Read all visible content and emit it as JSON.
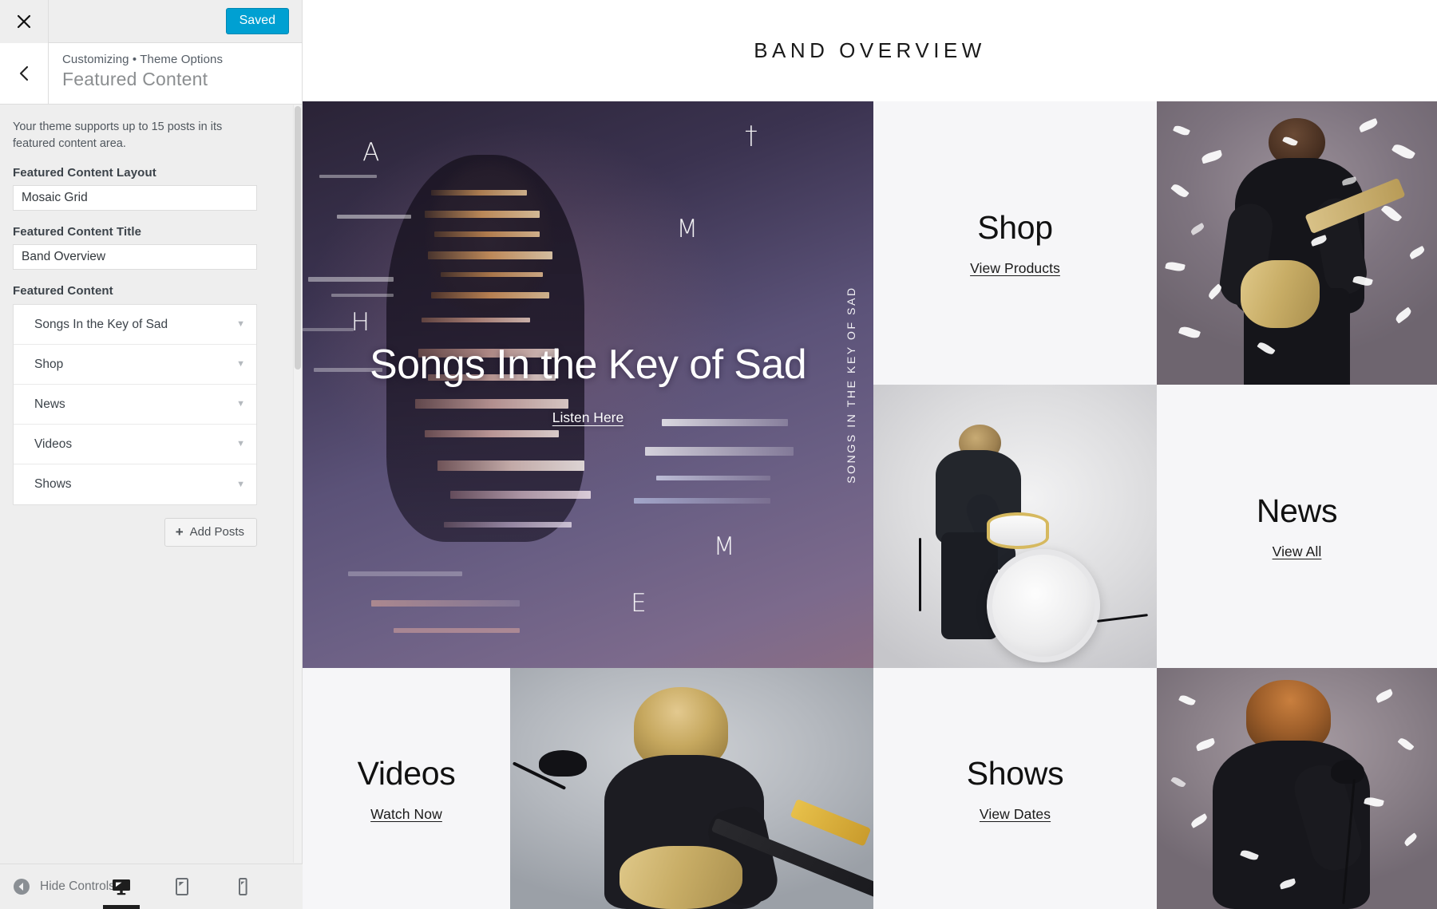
{
  "customizer": {
    "close_label": "Close",
    "save_label": "Saved",
    "back_label": "Back",
    "breadcrumb": "Customizing • Theme Options",
    "panel_name": "Featured Content",
    "accent_color": "#00a0d2",
    "description": "Your theme supports up to 15 posts in its featured content area.",
    "fields": [
      {
        "label": "Featured Content Layout",
        "value": "Mosaic Grid"
      },
      {
        "label": "Featured Content Title",
        "value": "Band Overview"
      }
    ],
    "featured_content": {
      "label": "Featured Content",
      "items": [
        {
          "title": "Songs In the Key of Sad"
        },
        {
          "title": "Shop"
        },
        {
          "title": "News"
        },
        {
          "title": "Videos"
        },
        {
          "title": "Shows"
        }
      ]
    },
    "add_posts_label": "Add Posts",
    "footer": {
      "hide_controls_label": "Hide Controls",
      "devices": [
        {
          "name": "desktop",
          "active": true
        },
        {
          "name": "tablet",
          "active": false
        },
        {
          "name": "mobile",
          "active": false
        }
      ]
    }
  },
  "preview": {
    "site_title": "BAND OVERVIEW",
    "hero": {
      "title": "Songs In the Key of Sad",
      "link_label": "Listen Here",
      "vertical_caption": "SONGS IN THE KEY OF SAD",
      "glyphs": [
        "A",
        "†",
        "M",
        "H",
        "M",
        "E"
      ]
    },
    "tiles": [
      {
        "heading": "Shop",
        "link_label": "View Products"
      },
      {
        "heading": "News",
        "link_label": "View All"
      },
      {
        "heading": "Videos",
        "link_label": "Watch Now"
      },
      {
        "heading": "Shows",
        "link_label": "View Dates"
      }
    ],
    "photos": [
      {
        "caption": "guitarist-with-feathers"
      },
      {
        "caption": "drummer-with-kit"
      },
      {
        "caption": "guitarist-at-microphone"
      },
      {
        "caption": "singer-with-microphone"
      }
    ]
  }
}
